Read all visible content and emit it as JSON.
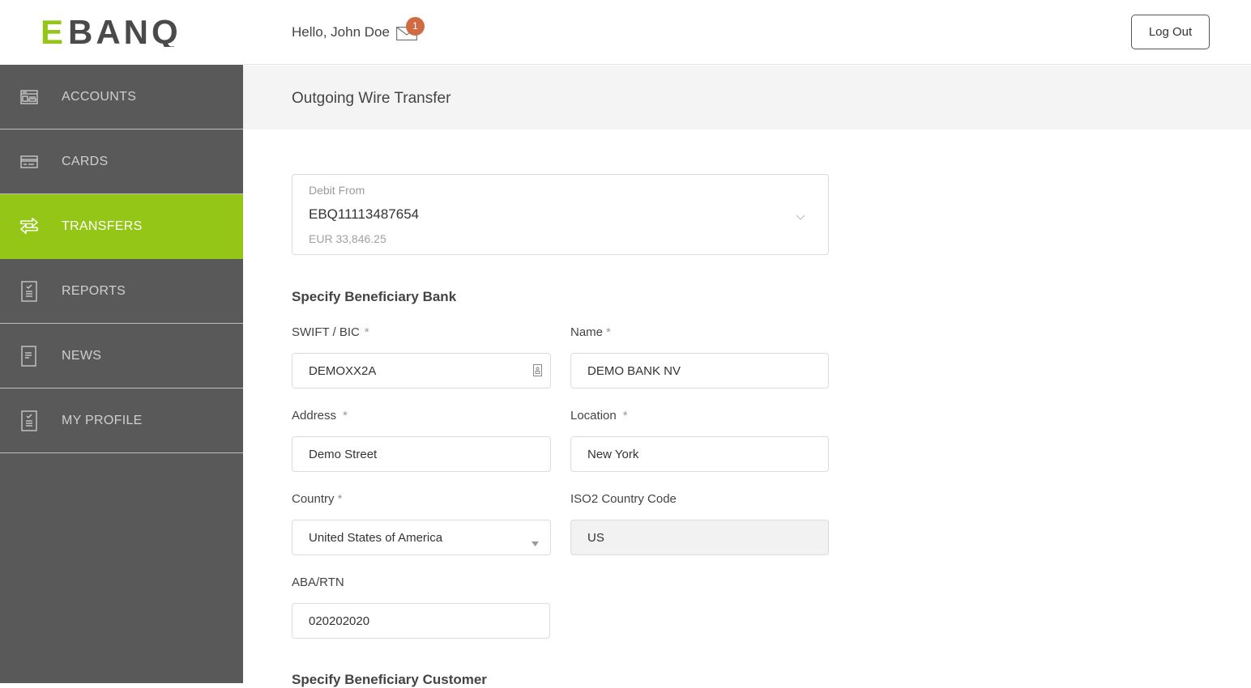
{
  "brand": {
    "logo_text_accent": "E",
    "logo_text_rest": "BANQ",
    "accent_color": "#93c617",
    "logo_gray": "#4a4a4a"
  },
  "header": {
    "greeting": "Hello, John Doe",
    "notification_count": "1",
    "logout_label": "Log Out"
  },
  "sidebar": {
    "items": [
      {
        "label": "ACCOUNTS",
        "icon": "accounts-icon",
        "active": false
      },
      {
        "label": "CARDS",
        "icon": "card-icon",
        "active": false
      },
      {
        "label": "TRANSFERS",
        "icon": "transfer-arrows-icon",
        "active": true
      },
      {
        "label": "REPORTS",
        "icon": "report-checklist-icon",
        "active": false
      },
      {
        "label": "NEWS",
        "icon": "news-document-icon",
        "active": false
      },
      {
        "label": "MY PROFILE",
        "icon": "profile-checklist-icon",
        "active": false
      }
    ]
  },
  "page": {
    "title": "Outgoing Wire Transfer"
  },
  "debit_from": {
    "label": "Debit From",
    "account": "EBQ11113487654",
    "balance": "EUR 33,846.25"
  },
  "beneficiary_bank": {
    "section_title": "Specify Beneficiary Bank",
    "swift": {
      "label": "SWIFT / BIC",
      "required": "*",
      "value": "DEMOXX2A"
    },
    "name": {
      "label": "Name",
      "required": "*",
      "value": "DEMO BANK NV"
    },
    "address": {
      "label": "Address",
      "required": "*",
      "value": "Demo Street"
    },
    "location": {
      "label": "Location",
      "required": "*",
      "value": "New York"
    },
    "country": {
      "label": "Country",
      "required": "*",
      "value": "United States of America"
    },
    "iso2": {
      "label": "ISO2 Country Code",
      "value": "US"
    },
    "aba": {
      "label": "ABA/RTN",
      "value": "020202020"
    }
  },
  "beneficiary_customer": {
    "section_title": "Specify Beneficiary Customer"
  }
}
